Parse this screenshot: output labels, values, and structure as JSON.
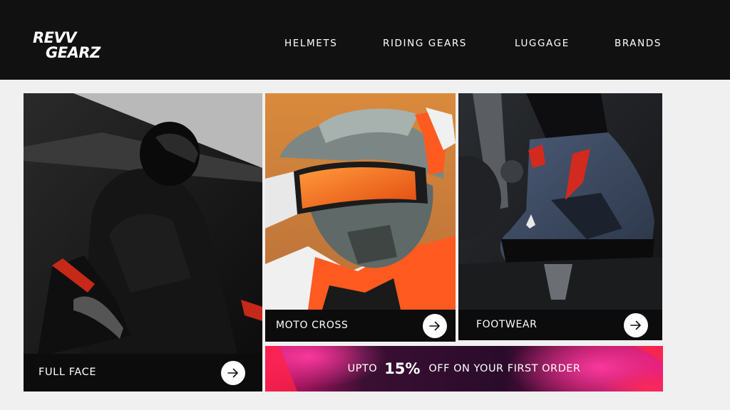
{
  "brand": {
    "logo_line1": "REVV",
    "logo_line2": "GEARZ"
  },
  "nav": {
    "items": [
      {
        "label": "HELMETS"
      },
      {
        "label": "RIDING GEARS"
      },
      {
        "label": "LUGGAGE"
      },
      {
        "label": "BRANDS"
      }
    ]
  },
  "categories": [
    {
      "label": "FULL FACE",
      "image": "rider-full-face-helmet-photo"
    },
    {
      "label": "MOTO CROSS",
      "image": "motocross-helmet-goggles-photo"
    },
    {
      "label": "FOOTWEAR",
      "image": "riding-boot-on-footpeg-photo"
    }
  ],
  "promo": {
    "prefix": "UPTO",
    "percent": "15%",
    "suffix": "OFF ON YOUR FIRST ORDER"
  },
  "colors": {
    "header_bg": "#111111",
    "page_bg": "#f0f0f0",
    "accent_orange": "#ff5a1f",
    "promo_pink": "#ff1f8e"
  }
}
